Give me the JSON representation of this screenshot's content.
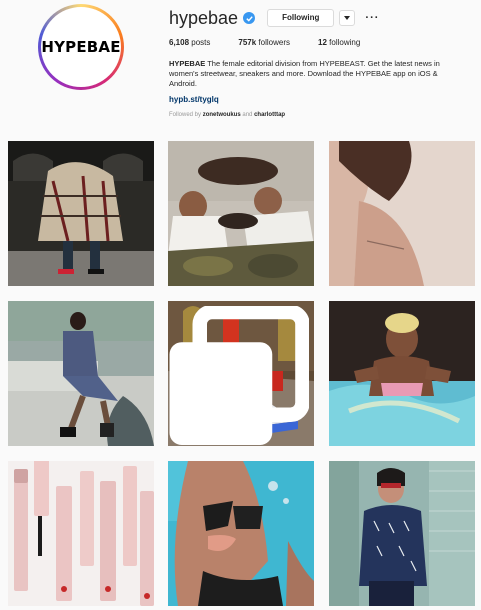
{
  "profile": {
    "username": "hypebae",
    "avatar_text": "HYPEBAE",
    "verified": true,
    "follow_label": "Following",
    "more_label": "···"
  },
  "stats": {
    "posts_count": "6,108",
    "posts_label": "posts",
    "followers_count": "757k",
    "followers_label": "followers",
    "following_count": "12",
    "following_label": "following"
  },
  "bio": {
    "name": "HYPEBAE",
    "text": " The female editorial division from HYPEBEAST. Get the latest news in women's streetwear, sneakers and more. Download the HYPEBAE app on iOS & Android.",
    "link": "hypb.st/tyglq"
  },
  "followed_by": {
    "prefix": "Followed by ",
    "user1": "zonetwoukus",
    "joiner": " and ",
    "user2": "charlotttap"
  },
  "posts": [
    {
      "subject": "couple in plaid blanket coat",
      "multi": false
    },
    {
      "subject": "mother and children lying together",
      "multi": false
    },
    {
      "subject": "neck tattoo closeup",
      "multi": false
    },
    {
      "subject": "woman sitting on ledge",
      "multi": false
    },
    {
      "subject": "red and blue store interior",
      "multi": true
    },
    {
      "subject": "woman in bathtub",
      "multi": false
    },
    {
      "subject": "glossier mascara tubes",
      "multi": false
    },
    {
      "subject": "woman in pool with drink",
      "multi": false
    },
    {
      "subject": "woman in denim jacket",
      "multi": false
    }
  ],
  "colors": {
    "verified": "#3897f0",
    "link": "#003569",
    "background": "#fafafa"
  }
}
